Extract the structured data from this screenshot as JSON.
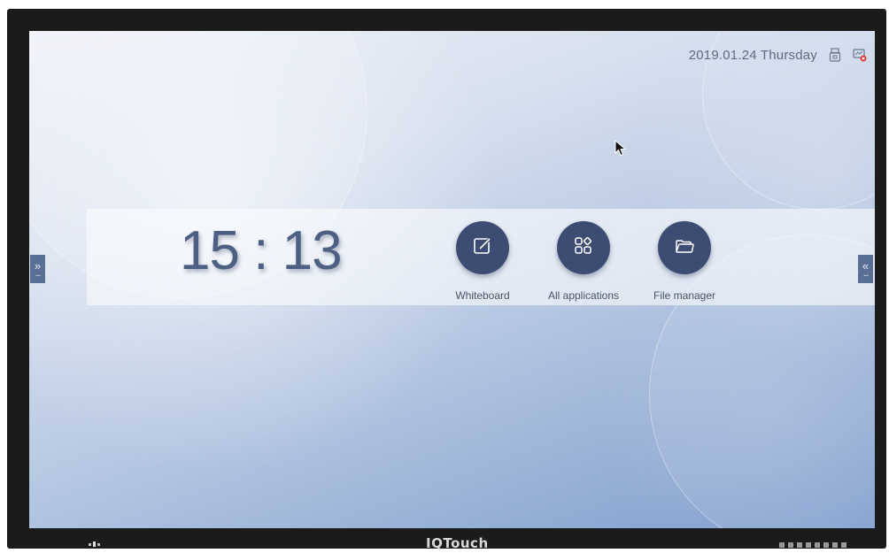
{
  "status_bar": {
    "date": "2019.01.24 Thursday",
    "usb_icon": "usb-drive-icon",
    "network_icon": "network-disconnected-icon"
  },
  "clock": {
    "time": "15 : 13"
  },
  "apps": [
    {
      "label": "Whiteboard",
      "icon": "edit-square-icon"
    },
    {
      "label": "All applications",
      "icon": "apps-grid-icon"
    },
    {
      "label": "File manager",
      "icon": "folder-icon"
    }
  ],
  "side_tabs": {
    "left_arrow": "»",
    "right_arrow": "«",
    "dots": "..."
  },
  "bezel": {
    "brand": "IQTouch"
  },
  "colors": {
    "app_button": "#3c4c72",
    "clock_text": "#4d5f82",
    "side_tab": "#5a6f96",
    "bezel": "#1b1b1b"
  }
}
